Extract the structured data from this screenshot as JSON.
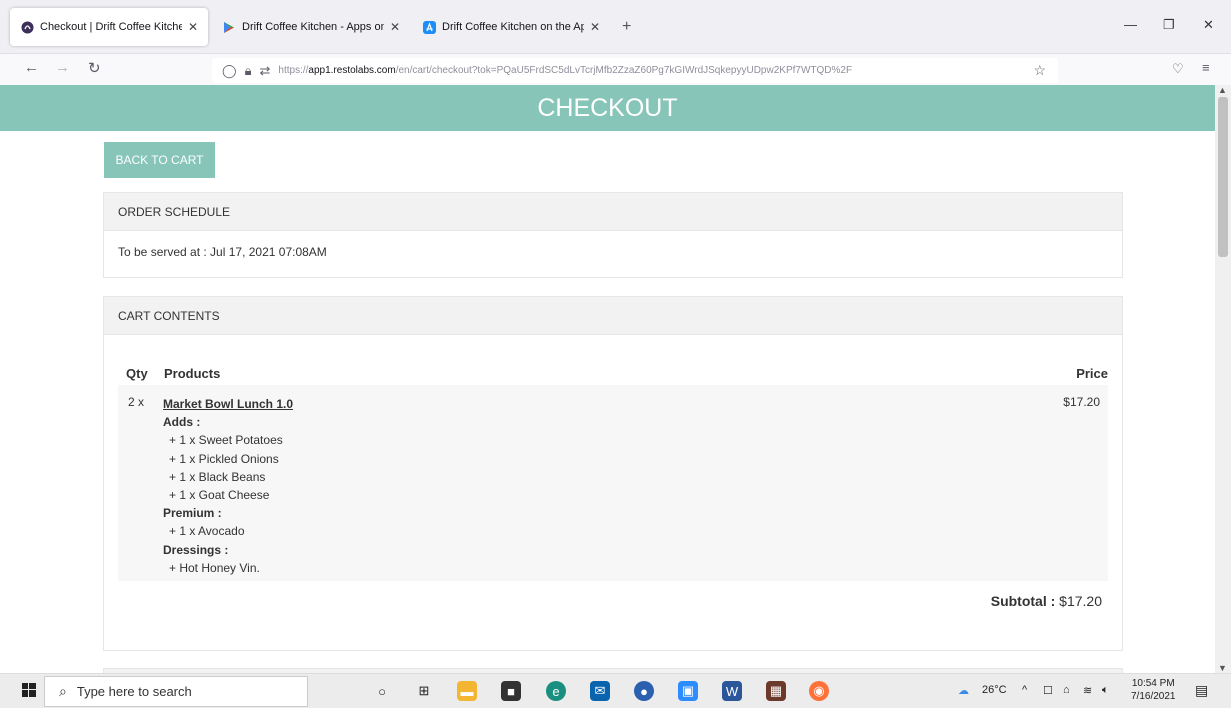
{
  "browser": {
    "tabs": [
      {
        "title": "Checkout | Drift Coffee Kitchen",
        "active": true,
        "favicon": "drift-icon"
      },
      {
        "title": "Drift Coffee Kitchen - Apps on G",
        "active": false,
        "favicon": "google-play-icon"
      },
      {
        "title": "Drift Coffee Kitchen on the App",
        "active": false,
        "favicon": "app-store-icon"
      }
    ],
    "url_prefix": "https://",
    "url_domain": "app1.restolabs.com",
    "url_path": "/en/cart/checkout?tok=PQaU5FrdSC5dLvTcrjMfb2ZzaZ60Pg7kGIWrdJSqkepyyUDpw2KPf7WTQD%2F"
  },
  "page": {
    "header_title": "CHECKOUT",
    "back_button": "BACK TO CART",
    "order_schedule": {
      "heading": "ORDER SCHEDULE",
      "served_at": "To be served at : Jul 17, 2021 07:08AM"
    },
    "cart": {
      "heading": "CART CONTENTS",
      "col_qty": "Qty",
      "col_products": "Products",
      "col_price": "Price",
      "item": {
        "qty": "2 x",
        "name": "Market Bowl Lunch 1.0",
        "price": "$17.20",
        "adds_label": "Adds :",
        "adds": [
          "+ 1 x Sweet Potatoes",
          "+ 1 x Pickled Onions",
          "+ 1 x Black Beans",
          "+ 1 x Goat Cheese"
        ],
        "premium_label": "Premium :",
        "premium": [
          "+ 1 x Avocado"
        ],
        "dressings_label": "Dressings :",
        "dressings": [
          "+ Hot Honey Vin."
        ]
      },
      "subtotal_label": "Subtotal :",
      "subtotal_value": "$17.20"
    }
  },
  "taskbar": {
    "search_placeholder": "Type here to search",
    "temperature": "26°C",
    "time": "10:54 PM",
    "date": "7/16/2021"
  },
  "colors": {
    "accent": "#86c5b8"
  }
}
